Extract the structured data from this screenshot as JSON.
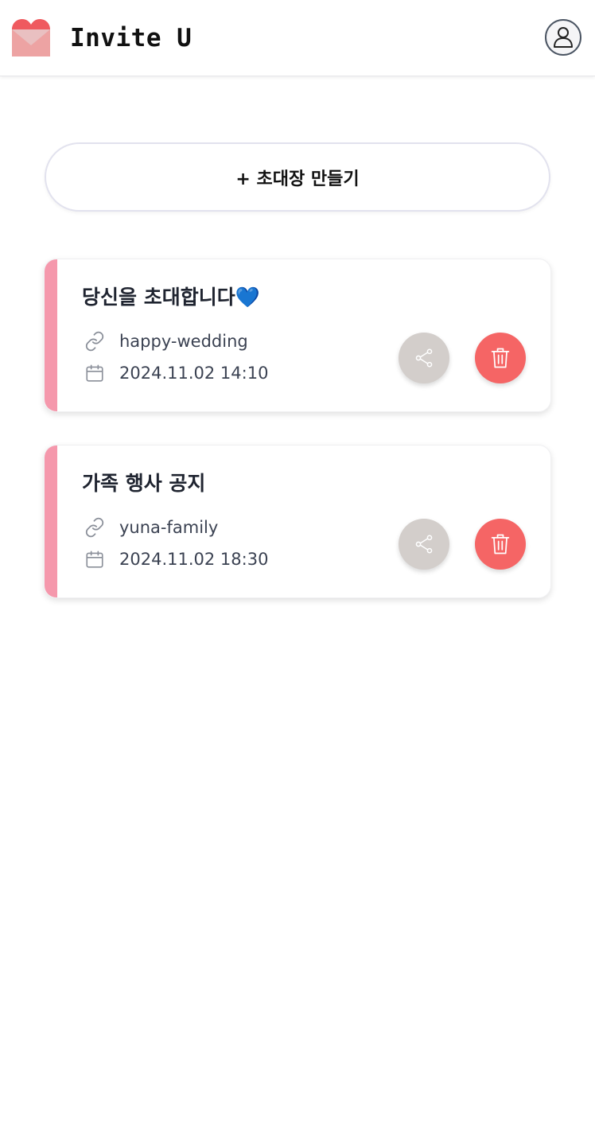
{
  "header": {
    "app_title": "Invite U",
    "logo_icon": "heart-envelope-icon",
    "profile_icon": "user-icon"
  },
  "create_button": {
    "label": "+ 초대장 만들기"
  },
  "invitations": [
    {
      "title": "당신을 초대합니다💙",
      "slug": "happy-wedding",
      "datetime": "2024.11.02 14:10"
    },
    {
      "title": "가족 행사 공지",
      "slug": "yuna-family",
      "datetime": "2024.11.02 18:30"
    }
  ],
  "icons": {
    "link": "link-icon",
    "calendar": "calendar-icon",
    "share": "share-icon",
    "delete": "trash-icon"
  },
  "colors": {
    "accent_pink": "#f598ac",
    "delete_red": "#f56565",
    "share_gray": "#d3cecb",
    "logo_red": "#ef5a5f"
  }
}
